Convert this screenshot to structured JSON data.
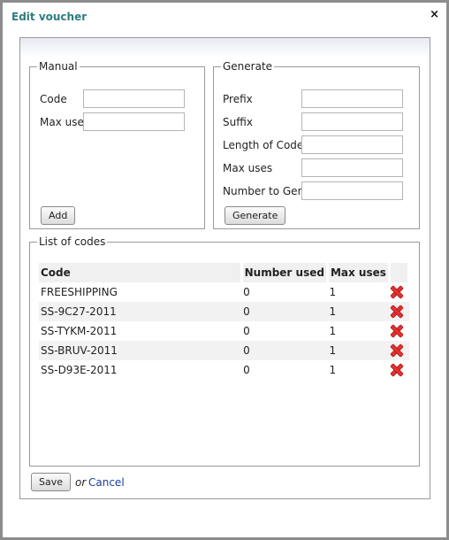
{
  "dialog": {
    "title": "Edit voucher",
    "close_glyph": "×"
  },
  "manual": {
    "legend": "Manual",
    "code_label": "Code",
    "code_value": "",
    "maxuse_label": "Max use",
    "maxuse_value": "",
    "add_label": "Add"
  },
  "generate": {
    "legend": "Generate",
    "prefix_label": "Prefix",
    "suffix_label": "Suffix",
    "length_label": "Length of Code",
    "maxuses_label": "Max uses",
    "number_label": "Number to Gen",
    "generate_label": "Generate"
  },
  "list": {
    "legend": "List of codes",
    "headers": {
      "code": "Code",
      "used": "Number used",
      "max": "Max uses"
    },
    "rows": [
      {
        "code": "FREESHIPPING",
        "used": "0",
        "max": "1"
      },
      {
        "code": "SS-9C27-2011",
        "used": "0",
        "max": "1"
      },
      {
        "code": "SS-TYKM-2011",
        "used": "0",
        "max": "1"
      },
      {
        "code": "SS-BRUV-2011",
        "used": "0",
        "max": "1"
      },
      {
        "code": "SS-D93E-2011",
        "used": "0",
        "max": "1"
      }
    ],
    "delete_icon": "delete-x-icon"
  },
  "footer": {
    "save_label": "Save",
    "or_text": "or",
    "cancel_label": "Cancel"
  },
  "colors": {
    "title": "#2e7d7d",
    "link": "#1a3ea0",
    "delete": "#e03030"
  }
}
